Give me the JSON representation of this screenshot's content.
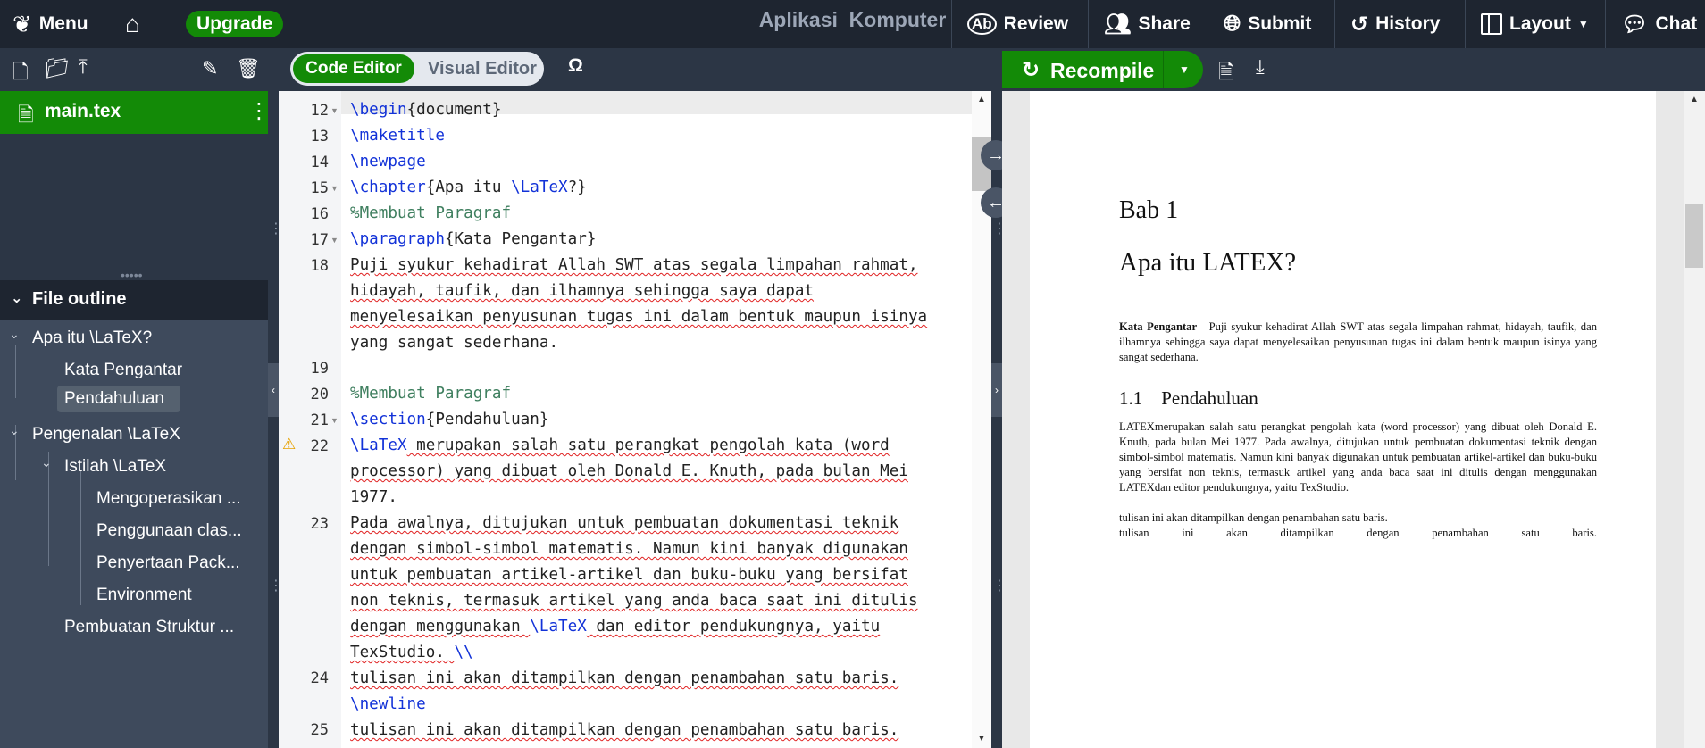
{
  "topbar": {
    "menu": "Menu",
    "upgrade": "Upgrade",
    "project_title": "Aplikasi_Komputer",
    "review": "Review",
    "share": "Share",
    "submit": "Submit",
    "history": "History",
    "layout": "Layout",
    "chat": "Chat"
  },
  "file_tree": {
    "active_file": "main.tex"
  },
  "outline": {
    "heading": "File outline",
    "items": [
      "Apa itu \\LaTeX?",
      "Kata Pengantar",
      "Pendahuluan",
      "Pengenalan \\LaTeX",
      "Istilah \\LaTeX",
      "Mengoperasikan ...",
      "Penggunaan clas...",
      "Penyertaan Pack...",
      "Environment",
      "Pembuatan Struktur ..."
    ]
  },
  "editor": {
    "code_editor": "Code Editor",
    "visual_editor": "Visual Editor",
    "symbol": "Ω",
    "line_numbers": [
      "12",
      "13",
      "14",
      "15",
      "16",
      "17",
      "18",
      "19",
      "20",
      "21",
      "22",
      "23",
      "24",
      "25"
    ],
    "lines": {
      "l12a": "\\begin",
      "l12b": "{document}",
      "l13": "\\maketitle",
      "l14": "\\newpage",
      "l15a": "\\chapter",
      "l15b": "{Apa itu ",
      "l15c": "\\LaTeX",
      "l15d": "?}",
      "l16": "%Membuat Paragraf",
      "l17a": "\\paragraph",
      "l17b": "{Kata Pengantar}",
      "l18_1": "Puji syukur kehadirat Allah SWT atas segala limpahan rahmat,",
      "l18_2": "hidayah, taufik, dan ilhamnya sehingga saya dapat",
      "l18_3": "menyelesaikan penyusunan tugas ini dalam bentuk maupun isinya",
      "l18_4": "yang sangat sederhana.",
      "l20": "%Membuat Paragraf",
      "l21a": "\\section",
      "l21b": "{Pendahuluan}",
      "l22a": "\\LaTeX",
      "l22b": " merupakan salah satu perangkat pengolah kata (word",
      "l22_2": "processor) yang dibuat oleh Donald E. Knuth, pada bulan Mei",
      "l22_3": "1977.",
      "l23_1": "Pada awalnya, ditujukan untuk pembuatan dokumentasi teknik",
      "l23_2": "dengan simbol-simbol matematis. Namun kini banyak digunakan",
      "l23_3": "untuk pembuatan artikel-artikel dan buku-buku yang bersifat",
      "l23_4": "non teknis, termasuk artikel yang anda baca saat ini ditulis",
      "l23_5a": "dengan menggunakan ",
      "l23_5b": "\\LaTeX",
      "l23_5c": " dan editor pendukungnya, yaitu",
      "l23_6a": "TexStudio. ",
      "l23_6b": "\\\\",
      "l24_1": "tulisan ini akan ditampilkan dengan penambahan satu baris.",
      "l24_2": "\\newline",
      "l25_1": "tulisan ini akan ditampilkan dengan penambahan satu baris."
    }
  },
  "pdf": {
    "recompile": "Recompile",
    "chapter_label": "Bab 1",
    "chapter_title": "Apa itu LATEX?",
    "para_head": "Kata Pengantar",
    "para_1": "Puji syukur kehadirat Allah SWT atas segala limpahan rahmat, hidayah, taufik, dan ilhamnya sehingga saya dapat menyelesaikan penyusunan tugas ini dalam bentuk maupun isinya yang sangat sederhana.",
    "section_num": "1.1",
    "section_title": "Pendahuluan",
    "para_2": "LATEXmerupakan salah satu perangkat pengolah kata (word processor) yang dibuat oleh Donald E. Knuth, pada bulan Mei 1977. Pada awalnya, ditujukan untuk pembuatan dokumentasi teknik dengan simbol-simbol matematis. Namun kini banyak digunakan untuk pembuatan artikel-artikel dan buku-buku yang bersifat non teknis, termasuk artikel yang anda baca saat ini ditulis dengan menggunakan LATEXdan editor pendukungnya, yaitu TexStudio.",
    "para_3": "tulisan ini akan ditampilkan dengan penambahan satu baris.",
    "para_4": "tulisan ini akan ditampilkan dengan penambahan satu baris."
  }
}
